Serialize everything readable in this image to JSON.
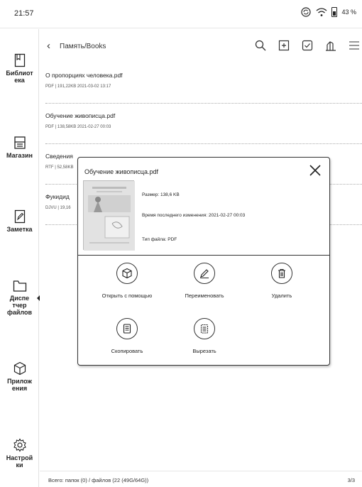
{
  "status": {
    "time": "21:57",
    "battery_percent": "43 %"
  },
  "sidebar": {
    "items": [
      {
        "label": "Библиот\nека"
      },
      {
        "label": "Магазин"
      },
      {
        "label": "Заметка"
      },
      {
        "label": "Диспе\nтчер\nфайлов"
      },
      {
        "label": "Прилож\nения"
      },
      {
        "label": "Настрой\nки"
      }
    ]
  },
  "header": {
    "breadcrumb": "Память/Books"
  },
  "files": [
    {
      "name": "О пропорциях человека.pdf",
      "meta": "PDF | 191,22KB   2021-03-02 13:17"
    },
    {
      "name": "Обучение живописца.pdf",
      "meta": "PDF | 138,58KB   2021-02-27 00:03"
    },
    {
      "name": "Сведения",
      "meta": "RTF | 52,58KB"
    },
    {
      "name": "Фукидид",
      "meta": "DJVU | 19,16"
    }
  ],
  "dialog": {
    "title": "Обучение живописца.pdf",
    "size": "Размер: 138,6 KB",
    "modified": "Время последнего изменения: 2021-02-27 00:03",
    "file_type": "Тип файла: PDF",
    "actions": {
      "open_with": "Открыть с помощью",
      "rename": "Переименовать",
      "delete": "Удалить",
      "copy": "Скопировать",
      "cut": "Вырезать"
    }
  },
  "footer": {
    "total": "Всего: папок (0) / файлов (22 (49G/64G))",
    "page": "3/3"
  }
}
